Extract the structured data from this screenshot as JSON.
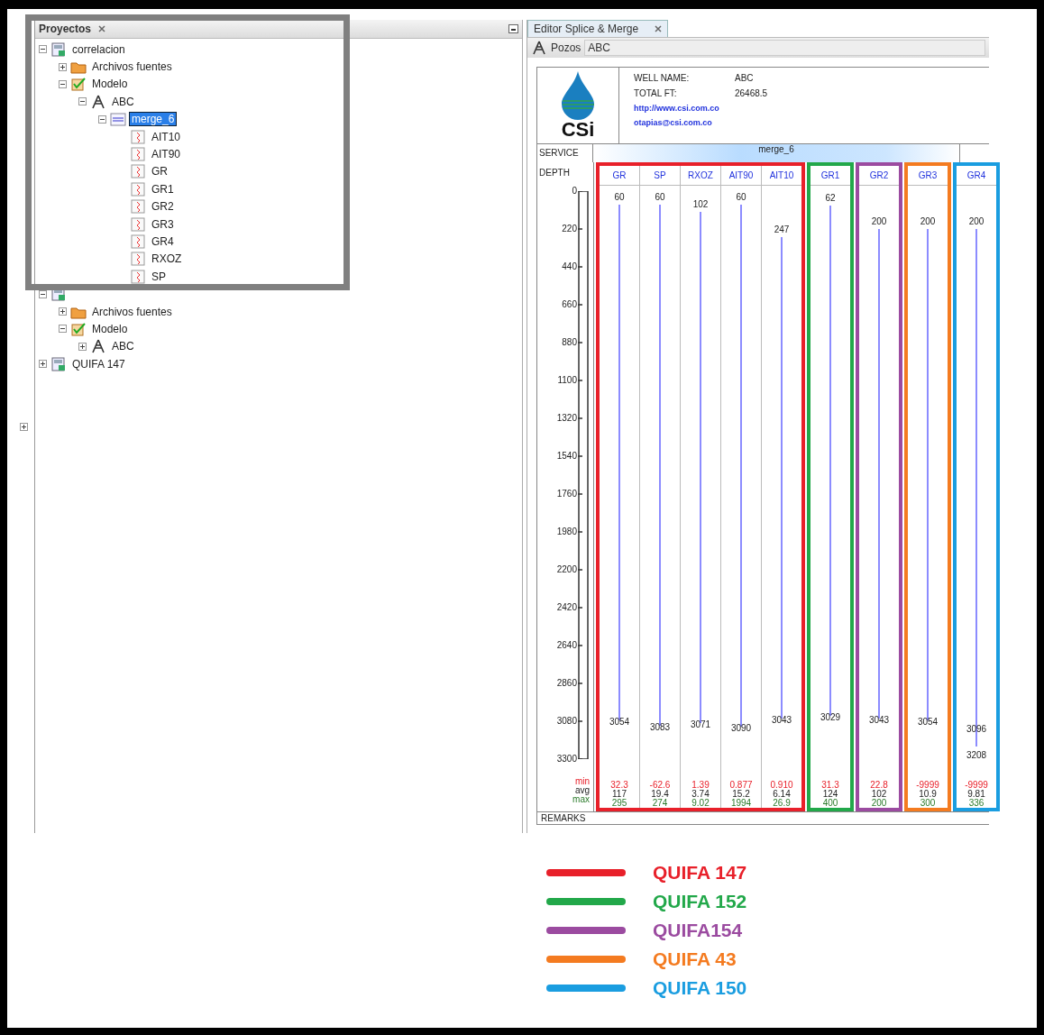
{
  "left_panel": {
    "tab": {
      "label": "Proyectos"
    },
    "tree": [
      {
        "label": "correlacion",
        "kind": "las",
        "expanded": true,
        "selected": false,
        "children": [
          {
            "label": "Archivos fuentes",
            "kind": "folder",
            "expanded": false,
            "selected": false
          },
          {
            "label": "Modelo",
            "kind": "model",
            "expanded": true,
            "selected": false,
            "children": [
              {
                "label": "ABC",
                "kind": "well",
                "expanded": true,
                "selected": false,
                "children": [
                  {
                    "label": "merge_6",
                    "kind": "log",
                    "expanded": true,
                    "selected": true,
                    "children": [
                      {
                        "label": "AIT10",
                        "kind": "curve",
                        "selected": false
                      },
                      {
                        "label": "AIT90",
                        "kind": "curve",
                        "selected": false
                      },
                      {
                        "label": "GR",
                        "kind": "curve",
                        "selected": false
                      },
                      {
                        "label": "GR1",
                        "kind": "curve",
                        "selected": false
                      },
                      {
                        "label": "GR2",
                        "kind": "curve",
                        "selected": false
                      },
                      {
                        "label": "GR3",
                        "kind": "curve",
                        "selected": false
                      },
                      {
                        "label": "GR4",
                        "kind": "curve",
                        "selected": false
                      },
                      {
                        "label": "RXOZ",
                        "kind": "curve",
                        "selected": false
                      },
                      {
                        "label": "SP",
                        "kind": "curve",
                        "selected": false
                      }
                    ]
                  }
                ]
              }
            ]
          }
        ]
      },
      {
        "kind": "las",
        "expanded": true,
        "children": [
          {
            "label": "Archivos fuentes",
            "kind": "folder",
            "expanded": false,
            "selected": false
          },
          {
            "label": "Modelo",
            "kind": "model",
            "expanded": true,
            "selected": false,
            "children": [
              {
                "label": "ABC",
                "kind": "well",
                "expanded": false,
                "selected": false
              }
            ]
          }
        ]
      },
      {
        "label": "QUIFA 147",
        "kind": "las",
        "expanded": false,
        "selected": false
      }
    ]
  },
  "right_panel": {
    "tab": {
      "label": "Editor Splice & Merge"
    },
    "toolbar": {
      "label": "Pozos",
      "value": "ABC"
    },
    "sheet": {
      "logo_text": "CSi",
      "fields": [
        {
          "label": "WELL NAME:",
          "value": "ABC"
        },
        {
          "label": "TOTAL FT:",
          "value": "26468.5"
        }
      ],
      "links": [
        "http://www.csi.com.co",
        "otapias@csi.com.co"
      ],
      "service_label": "SERVICE",
      "service_value": "merge_6",
      "depth_label": "DEPTH",
      "depth_ticks": [
        "0",
        "220",
        "440",
        "660",
        "880",
        "1100",
        "1320",
        "1540",
        "1760",
        "1980",
        "2200",
        "2420",
        "2640",
        "2860",
        "3080",
        "3300"
      ],
      "stat_labels": [
        "min",
        "avg",
        "max"
      ],
      "groups": [
        {
          "color": "#e8202a",
          "tracks": [
            {
              "name": "GR",
              "depth_labels": [
                "60",
                "3054"
              ],
              "min": "32.3",
              "avg": "117",
              "max": "295"
            },
            {
              "name": "SP",
              "depth_labels": [
                "60",
                "3083"
              ],
              "min": "-62.6",
              "avg": "19.4",
              "max": "274"
            },
            {
              "name": "RXOZ",
              "depth_labels": [
                "102",
                "3071"
              ],
              "min": "1.39",
              "avg": "3.74",
              "max": "9.02"
            },
            {
              "name": "AIT90",
              "depth_labels": [
                "60",
                "3090"
              ],
              "min": "0.877",
              "avg": "15.2",
              "max": "1994"
            },
            {
              "name": "AIT10",
              "depth_labels": [
                "247",
                "3043"
              ],
              "min": "0.910",
              "avg": "6.14",
              "max": "26.9"
            }
          ]
        },
        {
          "color": "#22a84a",
          "tracks": [
            {
              "name": "GR1",
              "depth_labels": [
                "62",
                "3029"
              ],
              "min": "31.3",
              "avg": "124",
              "max": "400"
            }
          ]
        },
        {
          "color": "#9b4ba0",
          "tracks": [
            {
              "name": "GR2",
              "depth_labels": [
                "200",
                "3043"
              ],
              "min": "22.8",
              "avg": "102",
              "max": "200"
            }
          ]
        },
        {
          "color": "#f47b20",
          "tracks": [
            {
              "name": "GR3",
              "depth_labels": [
                "200",
                "3054"
              ],
              "min": "-9999",
              "avg": "10.9",
              "max": "300"
            }
          ]
        },
        {
          "color": "#1a9de0",
          "tracks": [
            {
              "name": "GR4",
              "depth_labels": [
                "200",
                "3096",
                "3208"
              ],
              "min": "-9999",
              "avg": "9.81",
              "max": "336"
            }
          ]
        }
      ],
      "remarks_label": "REMARKS"
    }
  },
  "legend": [
    {
      "label": "QUIFA 147",
      "color": "#e8202a"
    },
    {
      "label": "QUIFA 152",
      "color": "#22a84a"
    },
    {
      "label": "QUIFA154",
      "color": "#9b4ba0"
    },
    {
      "label": "QUIFA 43",
      "color": "#f47b20"
    },
    {
      "label": "QUIFA 150",
      "color": "#1a9de0"
    }
  ]
}
